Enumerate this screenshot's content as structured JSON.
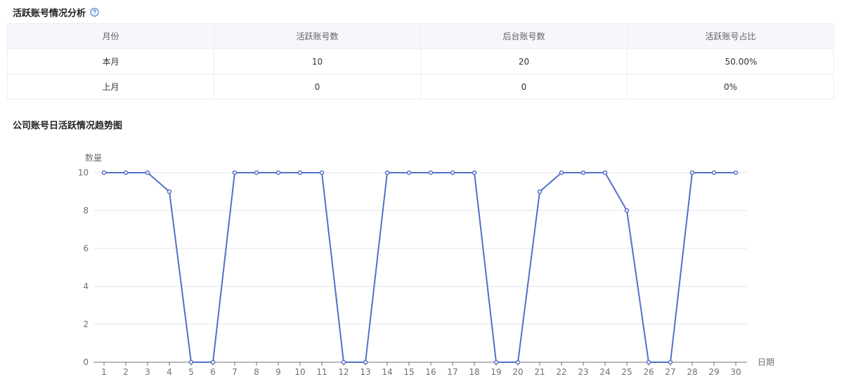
{
  "summary": {
    "title": "活跃账号情况分析",
    "help_icon": "question-circle-icon",
    "columns": [
      "月份",
      "活跃账号数",
      "后台账号数",
      "活跃账号占比"
    ],
    "rows": [
      [
        "本月",
        "10",
        "20",
        "50.00%"
      ],
      [
        "上月",
        "0",
        "0",
        "0%"
      ]
    ]
  },
  "trend": {
    "title": "公司账号日活跃情况趋势图"
  },
  "chart_data": {
    "type": "line",
    "title": "公司账号日活跃情况趋势图",
    "xlabel": "日期",
    "ylabel": "数量",
    "x": [
      "1",
      "2",
      "3",
      "4",
      "5",
      "6",
      "7",
      "8",
      "9",
      "10",
      "11",
      "12",
      "13",
      "14",
      "15",
      "16",
      "17",
      "18",
      "19",
      "20",
      "21",
      "22",
      "23",
      "24",
      "25",
      "26",
      "27",
      "28",
      "29",
      "30"
    ],
    "series": [
      {
        "values": [
          10,
          10,
          10,
          9,
          0,
          0,
          10,
          10,
          10,
          10,
          10,
          0,
          0,
          10,
          10,
          10,
          10,
          10,
          0,
          0,
          9,
          10,
          10,
          10,
          8,
          0,
          0,
          10,
          10,
          10
        ]
      }
    ],
    "ylim": [
      0,
      10
    ],
    "yticks": [
      0,
      2,
      4,
      6,
      8,
      10
    ],
    "grid": true,
    "line_color": "#5470c6"
  }
}
